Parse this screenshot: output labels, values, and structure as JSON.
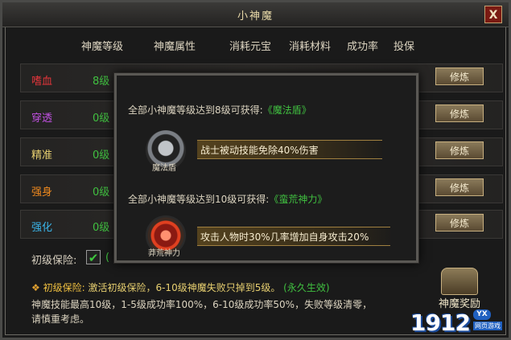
{
  "window": {
    "title": "小神魔",
    "close_label": "X"
  },
  "headers": [
    "神魔等级",
    "神魔属性",
    "消耗元宝",
    "消耗材料",
    "成功率",
    "投保"
  ],
  "rows": [
    {
      "name": "嗜血",
      "level": "8级",
      "button": "修炼",
      "color": "#e0353a"
    },
    {
      "name": "穿透",
      "level": "0级",
      "button": "修炼",
      "color": "#c050e0"
    },
    {
      "name": "精准",
      "level": "0级",
      "button": "修炼",
      "color": "#e8d070"
    },
    {
      "name": "强身",
      "level": "0级",
      "button": "修炼",
      "color": "#f08a1e"
    },
    {
      "name": "强化",
      "level": "0级",
      "button": "修炼",
      "color": "#3ab4e8"
    }
  ],
  "insurance": {
    "label": "初级保险:",
    "checked": true,
    "paren": "("
  },
  "tip": {
    "diamond": "❖",
    "label": "初级保险:",
    "text": "激活初级保险，6-10级神魔失败只掉到5级。",
    "perm": "(永久生效)"
  },
  "description": [
    "神魔技能最高10级，1-5级成功率100%，6-10级成功率50%，失败等级清零，",
    "请慎重考虑。"
  ],
  "reward_label": "神魔奖励",
  "popup": {
    "line1_prefix": "全部小神魔等级达到8级可获得:",
    "line1_item": "《魔法盾》",
    "icon1_label": "魔法盾",
    "bar1": "战士被动技能免除40%伤害",
    "line2_prefix": "全部小神魔等级达到10级可获得:",
    "line2_item": "《蛮荒神力》",
    "icon2_label": "莽荒神力",
    "bar2": "攻击人物时30%几率增加自身攻击20%"
  },
  "watermark": {
    "number": "1912",
    "badge": "YX",
    "subtitle": "网页游戏"
  }
}
